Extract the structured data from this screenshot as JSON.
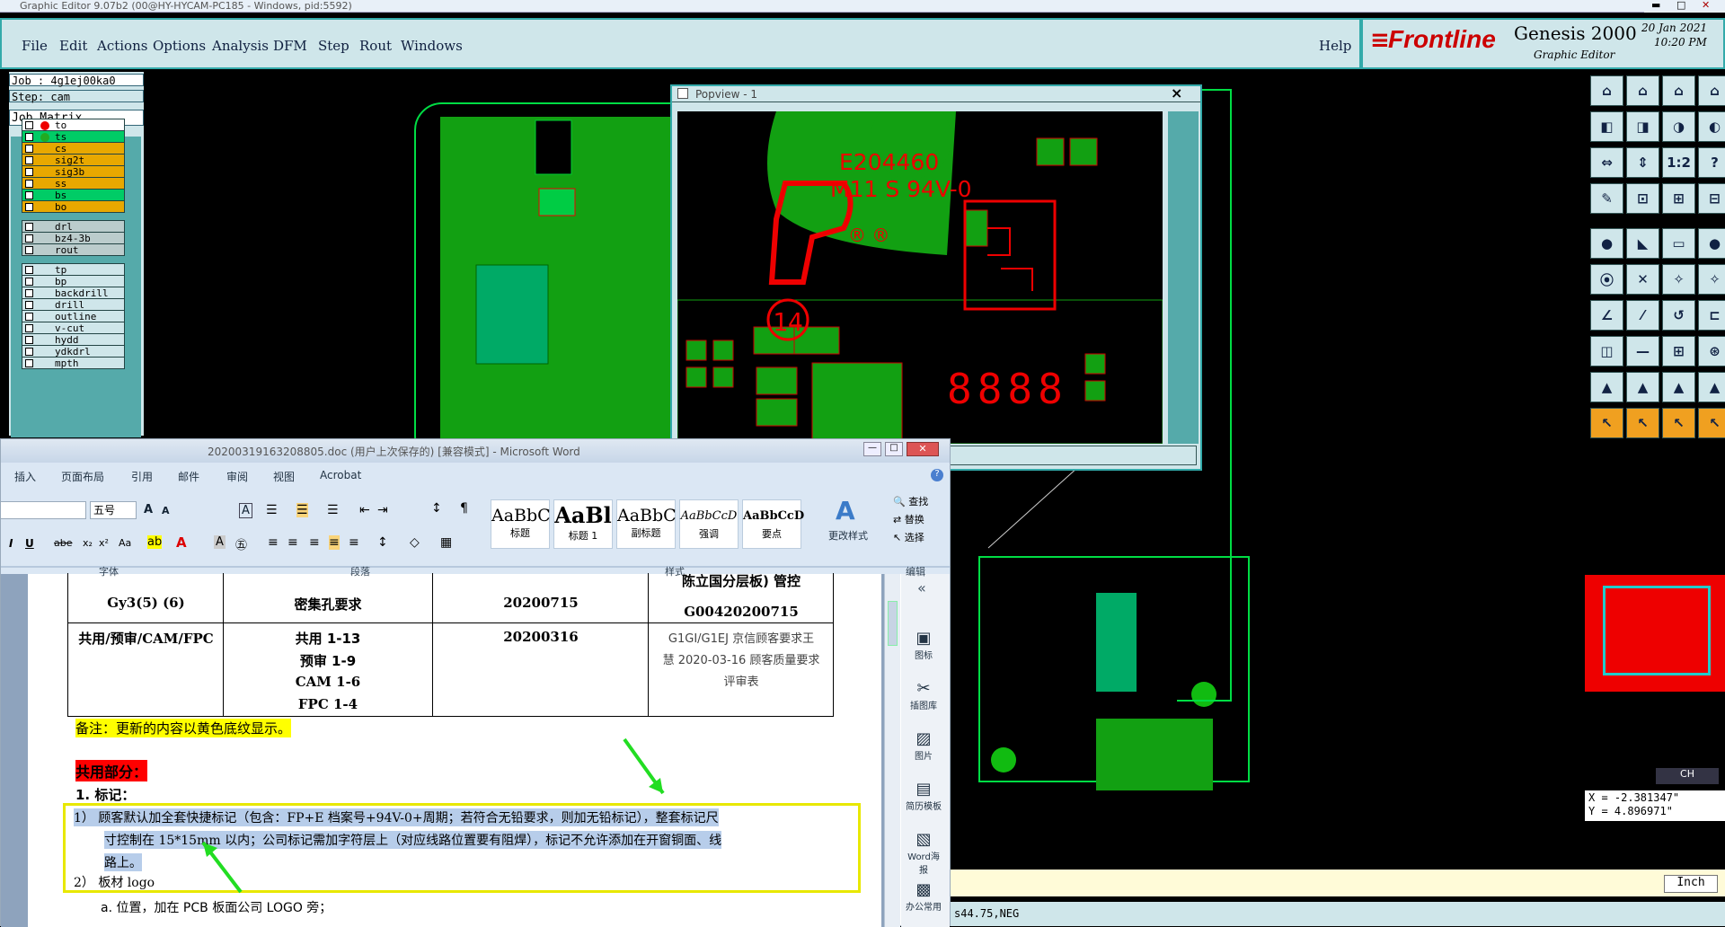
{
  "window": {
    "title": "Graphic Editor 9.07b2 (00@HY-HYCAM-PC185 - Windows, pid:5592)"
  },
  "menu": {
    "items": [
      "File",
      "Edit",
      "Actions",
      "Options",
      "Analysis",
      "DFM",
      "Step",
      "Rout",
      "Windows"
    ],
    "help": "Help"
  },
  "brand": {
    "logo": "Frontline",
    "product": "Genesis 2000",
    "subtitle": "Graphic Editor",
    "date": "20 Jan 2021",
    "time": "10:20 PM"
  },
  "job": {
    "job_label": "Job : 4g1ej00ka0",
    "step_label": "Step: cam",
    "matrix_button": "Job Matrix ..."
  },
  "layers": {
    "group1": [
      "to",
      "ts",
      "cs",
      "sig2t",
      "sig3b",
      "ss",
      "bs",
      "bo"
    ],
    "group2": [
      "drl",
      "bz4-3b",
      "rout"
    ],
    "group3": [
      "tp",
      "bp",
      "backdrill",
      "drill",
      "outline",
      "v-cut",
      "hydd",
      "ydkdrl",
      "mpth"
    ]
  },
  "popview": {
    "title": "Popview - 1",
    "close": "×",
    "ul_code": "E204460",
    "ul_rating": "M11 S 94V-0",
    "circle_num": "14",
    "date_code": "8888"
  },
  "coords": {
    "x": "X = -2.381347\"",
    "y": "Y = 4.896971\"",
    "unit": "Inch",
    "status": "s44.75,NEG",
    "badge": "CH"
  },
  "word": {
    "title": "20200319163208805.doc (用户上次保存的) [兼容模式] - Microsoft Word",
    "tabs": [
      "插入",
      "页面布局",
      "引用",
      "邮件",
      "审阅",
      "视图",
      "Acrobat"
    ],
    "font_size": "五号",
    "styles": [
      {
        "sample": "AaBbC",
        "name": "标题"
      },
      {
        "sample": "AaBl",
        "name": "标题 1"
      },
      {
        "sample": "AaBbC",
        "name": "副标题"
      },
      {
        "sample": "AaBbCcD",
        "name": "强调"
      },
      {
        "sample": "AaBbCcD",
        "name": "要点"
      }
    ],
    "change_styles": "更改样式",
    "edit": {
      "find": "查找",
      "replace": "替换",
      "select": "选择"
    },
    "groups": [
      "字体",
      "段落",
      "样式",
      "编辑"
    ],
    "table": {
      "row1": [
        "Gy3(5) (6)",
        "密集孔要求",
        "20200715",
        "陈立国分层板) 管控",
        "G00420200715"
      ],
      "row2": {
        "c1": "共用/预审/CAM/FPC",
        "c2": [
          "共用 1-13",
          "预审 1-9",
          "CAM 1-6",
          "FPC 1-4"
        ],
        "c3": "20200316",
        "c4": [
          "G1GI/G1EJ 京信顾客要求王",
          "慧 2020-03-16 顾客质量要求",
          "评审表"
        ]
      }
    },
    "note": "备注：更新的内容以黄色底纹显示。",
    "section": "共用部分：",
    "item1": "1.    标记：",
    "para1_a": "1）  顾客默认加全套快捷标记（包含：FP+E 档案号+94V-0+周期；若符合无铅要求，则加无铅标记），整套标记尺",
    "para1_b": "寸控制在 15*15mm 以内；公司标记需加字符层上（对应线路位置要有阻焊），标记不允许添加在开窗铜面、线",
    "para1_c": "路上。",
    "para2": "2）  板材 logo",
    "para2a": "a.    位置，加在 PCB 板面公司 LOGO 旁；",
    "side": [
      "图标",
      "插图库",
      "图片",
      "简历模板",
      "Word海报",
      "办公常用"
    ]
  }
}
